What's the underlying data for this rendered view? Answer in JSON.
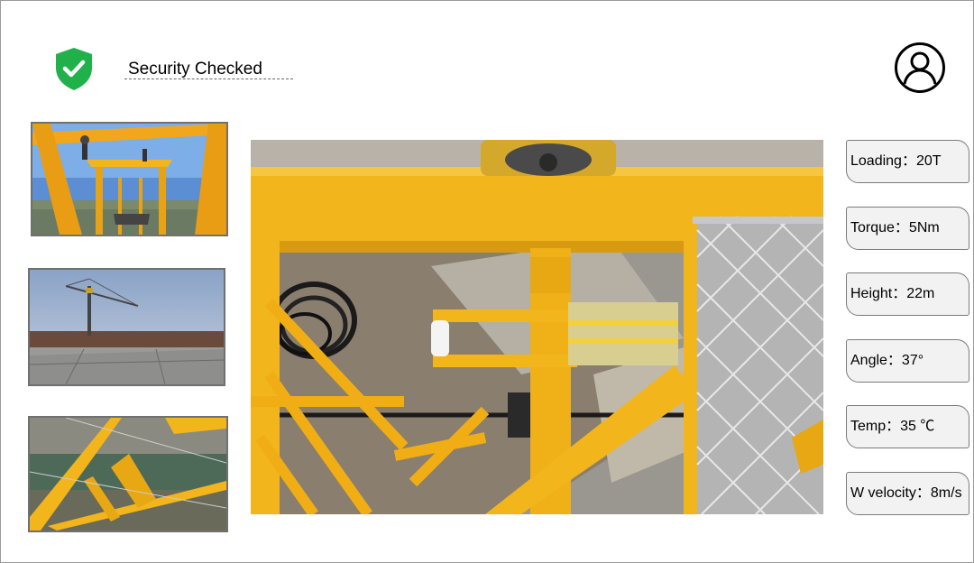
{
  "header": {
    "security_status": "Security Checked",
    "status_icon": "shield-check-icon",
    "status_color": "#21b14b",
    "user_icon": "user-avatar-icon"
  },
  "thumbnails": [
    {
      "name": "camera-view-crane-top"
    },
    {
      "name": "camera-view-site-overview"
    },
    {
      "name": "camera-view-jib-structure"
    }
  ],
  "main_view": {
    "name": "camera-view-trolley-detail"
  },
  "metrics": [
    {
      "label": "Loading：20T"
    },
    {
      "label": "Torque：5Nm"
    },
    {
      "label": "Height：22m"
    },
    {
      "label": "Angle：37°"
    },
    {
      "label": "Temp：35 ℃"
    },
    {
      "label": "W velocity：8m/s"
    }
  ],
  "colors": {
    "crane_yellow": "#f2b51c",
    "panel_bg": "#f2f2f2",
    "border": "#7a7a7a"
  }
}
